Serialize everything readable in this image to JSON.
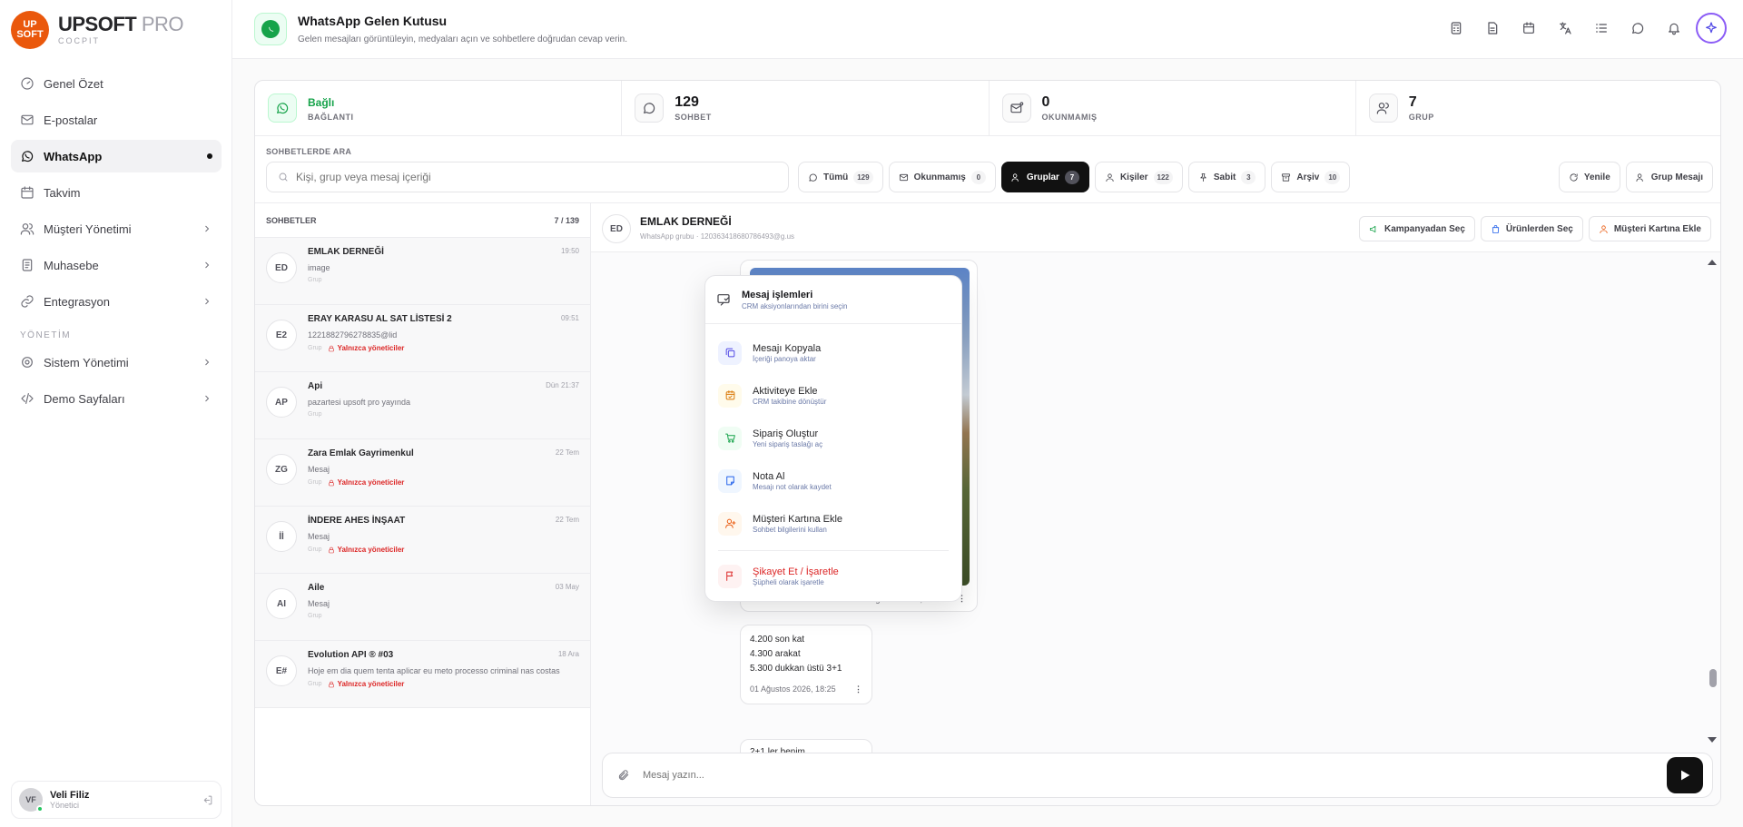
{
  "brand": {
    "name": "UPSOFT",
    "suffix": "PRO",
    "sub": "COCPIT",
    "logo_top": "UP",
    "logo_bottom": "SOFT"
  },
  "nav": {
    "items": [
      {
        "label": "Genel Özet"
      },
      {
        "label": "E-postalar"
      },
      {
        "label": "WhatsApp"
      },
      {
        "label": "Takvim"
      },
      {
        "label": "Müşteri Yönetimi"
      },
      {
        "label": "Muhasebe"
      },
      {
        "label": "Entegrasyon"
      }
    ],
    "section": "YÖNETİM",
    "admin_items": [
      {
        "label": "Sistem Yönetimi"
      },
      {
        "label": "Demo Sayfaları"
      }
    ]
  },
  "user": {
    "name": "Veli Filiz",
    "role": "Yönetici",
    "initials": "VF"
  },
  "header": {
    "title": "WhatsApp Gelen Kutusu",
    "subtitle": "Gelen mesajları görüntüleyin, medyaları açın ve sohbetlere doğrudan cevap verin."
  },
  "stats": [
    {
      "value": "Bağlı",
      "label": "BAĞLANTI"
    },
    {
      "value": "129",
      "label": "SOHBET"
    },
    {
      "value": "0",
      "label": "OKUNMAMIŞ"
    },
    {
      "value": "7",
      "label": "GRUP"
    }
  ],
  "search": {
    "caption": "SOHBETLERDE ARA",
    "placeholder": "Kişi, grup veya mesaj içeriği"
  },
  "filters": [
    {
      "label": "Tümü",
      "count": "129"
    },
    {
      "label": "Okunmamış",
      "count": "0"
    },
    {
      "label": "Gruplar",
      "count": "7"
    },
    {
      "label": "Kişiler",
      "count": "122"
    },
    {
      "label": "Sabit",
      "count": "3"
    },
    {
      "label": "Arşiv",
      "count": "10"
    }
  ],
  "actions": {
    "refresh": "Yenile",
    "group_message": "Grup Mesajı"
  },
  "chat_list": {
    "title": "SOHBETLER",
    "count": "7 / 139",
    "chats": [
      {
        "initials": "ED",
        "name": "EMLAK DERNEĞİ",
        "time": "19:50",
        "preview": "image",
        "tag": "Grup",
        "admins": ""
      },
      {
        "initials": "E2",
        "name": "ERAY KARASU AL SAT LİSTESİ 2",
        "time": "09:51",
        "preview": "1221882796278835@lid",
        "tag": "Grup",
        "admins": "Yalnızca yöneticiler"
      },
      {
        "initials": "AP",
        "name": "Api",
        "time": "Dün 21:37",
        "preview": "pazartesi upsoft pro yayında",
        "tag": "Grup",
        "admins": ""
      },
      {
        "initials": "ZG",
        "name": "Zara Emlak Gayrimenkul",
        "time": "22 Tem",
        "preview": "Mesaj",
        "tag": "Grup",
        "admins": "Yalnızca yöneticiler"
      },
      {
        "initials": "İİ",
        "name": "İNDERE AHES İNŞAAT",
        "time": "22 Tem",
        "preview": "Mesaj",
        "tag": "Grup",
        "admins": "Yalnızca yöneticiler"
      },
      {
        "initials": "AI",
        "name": "Aile",
        "time": "03 May",
        "preview": "Mesaj",
        "tag": "Grup",
        "admins": ""
      },
      {
        "initials": "E#",
        "name": "Evolution API ® #03",
        "time": "18 Ara",
        "preview": "Hoje em dia quem tenta aplicar eu meto processo criminal nas costas",
        "tag": "Grup",
        "admins": "Yalnızca yöneticiler"
      }
    ]
  },
  "conversation": {
    "initials": "ED",
    "name": "EMLAK DERNEĞİ",
    "subtitle": "WhatsApp grubu · 120363418680786493@g.us",
    "buttons": {
      "campaign": "Kampanyadan Seç",
      "products": "Ürünlerden Seç",
      "customer_card": "Müşteri Kartına Ekle"
    },
    "messages": [
      {
        "type": "image",
        "time": "01 Ağustos 2026, 18:24"
      },
      {
        "type": "text",
        "lines": [
          "4.200 son kat",
          "4.300 arakat",
          "5.300 dukkan üstü 3+1"
        ],
        "time": "01 Ağustos 2026, 18:25"
      },
      {
        "type": "text",
        "lines": [
          "2+1 ler benim"
        ]
      }
    ],
    "composer_placeholder": "Mesaj yazın..."
  },
  "context_menu": {
    "title": "Mesaj işlemleri",
    "subtitle": "CRM aksiyonlarından birini seçin",
    "items": [
      {
        "label": "Mesajı Kopyala",
        "sub": "İçeriği panoya aktar",
        "color": "#4f46e5",
        "bg": "#eef2ff"
      },
      {
        "label": "Aktiviteye Ekle",
        "sub": "CRM takibine dönüştür",
        "color": "#d97706",
        "bg": "#fffbeb"
      },
      {
        "label": "Sipariş Oluştur",
        "sub": "Yeni sipariş taslağı aç",
        "color": "#16a34a",
        "bg": "#f0fdf4"
      },
      {
        "label": "Nota Al",
        "sub": "Mesajı not olarak kaydet",
        "color": "#2563eb",
        "bg": "#eff6ff"
      },
      {
        "label": "Müşteri Kartına Ekle",
        "sub": "Sohbet bilgilerini kullan",
        "color": "#ea580c",
        "bg": "#fff7ed"
      },
      {
        "label": "Şikayet Et / İşaretle",
        "sub": "Şüpheli olarak işaretle",
        "color": "#dc2626",
        "bg": "#fef2f2"
      }
    ]
  },
  "colors": {
    "accent": "#ea580c",
    "whatsapp": "#16a34a",
    "danger": "#dc2626",
    "active": "#111111"
  }
}
